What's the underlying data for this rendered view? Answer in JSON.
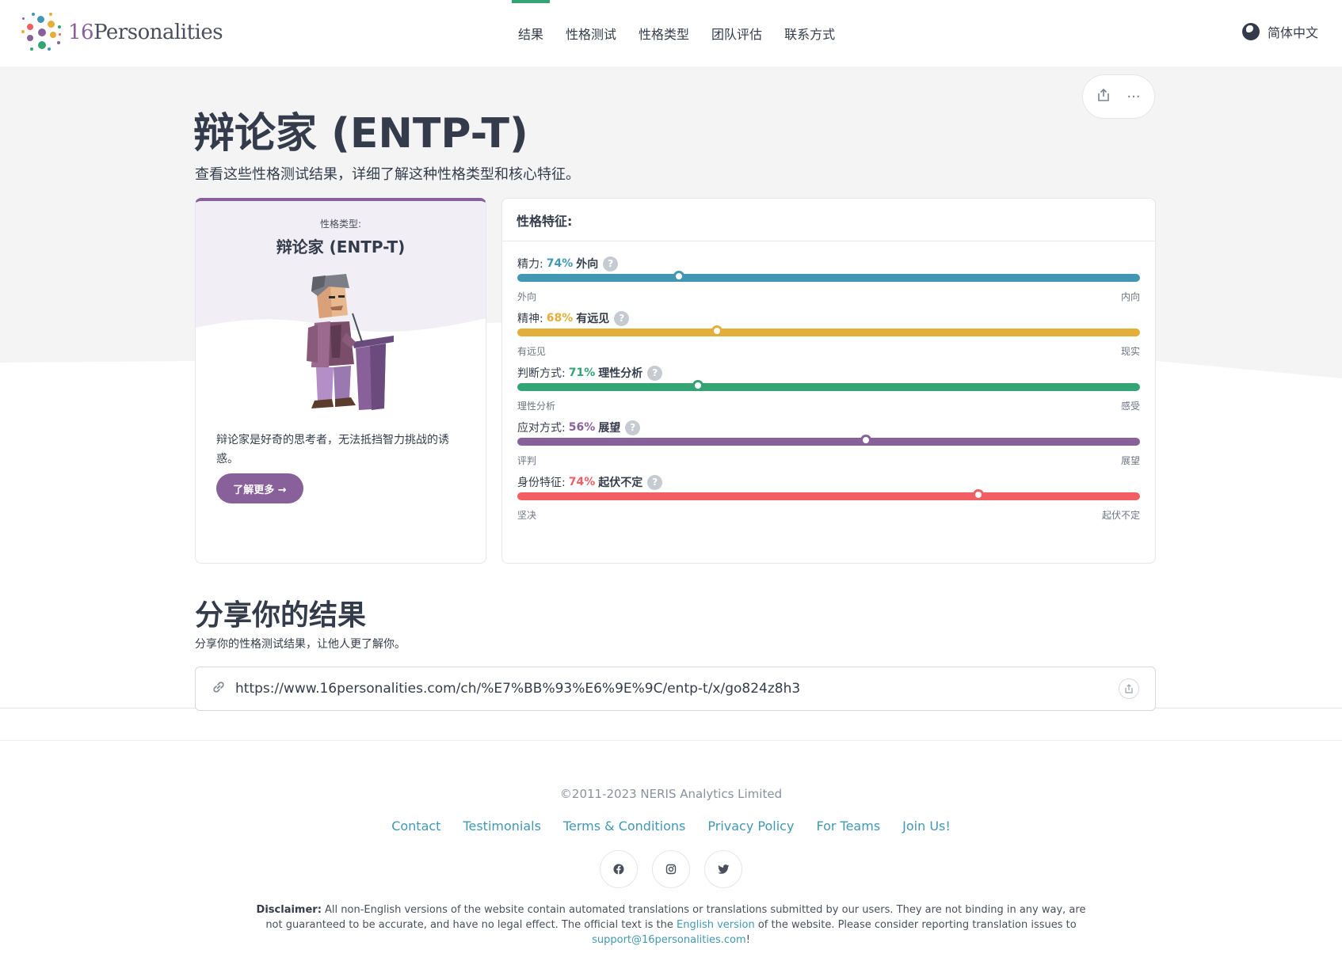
{
  "header": {
    "logo_num": "16",
    "logo_word": "Personalities",
    "nav": [
      {
        "label": "结果",
        "active": true
      },
      {
        "label": "性格测试",
        "active": false
      },
      {
        "label": "性格类型",
        "active": false
      },
      {
        "label": "团队评估",
        "active": false
      },
      {
        "label": "联系方式",
        "active": false
      }
    ],
    "language": "简体中文"
  },
  "page": {
    "title": "辩论家 (ENTP-T)",
    "subtitle": "查看这些性格测试结果，详细了解这种性格类型和核心特征。",
    "actions": {
      "share_icon": "share-icon",
      "more_icon": "more-icon"
    }
  },
  "type_card": {
    "label": "性格类型:",
    "name": "辩论家 (ENTP-T)",
    "description": "辩论家是好奇的思考者，无法抵挡智力挑战的诱惑。",
    "button": "了解更多 →",
    "accent": "#88619a"
  },
  "traits": {
    "heading": "性格特征:",
    "items": [
      {
        "prefix": "精力:",
        "percent": "74%",
        "name": "外向",
        "left": "外向",
        "right": "内向",
        "color": "#4298b4",
        "position": 0.26
      },
      {
        "prefix": "精神:",
        "percent": "68%",
        "name": "有远见",
        "left": "有远见",
        "right": "现实",
        "color": "#e4ae3a",
        "position": 0.32
      },
      {
        "prefix": "判断方式:",
        "percent": "71%",
        "name": "理性分析",
        "left": "理性分析",
        "right": "感受",
        "color": "#33a474",
        "position": 0.29
      },
      {
        "prefix": "应对方式:",
        "percent": "56%",
        "name": "展望",
        "left": "评判",
        "right": "展望",
        "color": "#88619a",
        "position": 0.56
      },
      {
        "prefix": "身份特征:",
        "percent": "74%",
        "name": "起伏不定",
        "left": "坚决",
        "right": "起伏不定",
        "color": "#f25e62",
        "position": 0.74
      }
    ]
  },
  "share": {
    "title": "分享你的结果",
    "subtitle": "分享你的性格测试结果，让他人更了解你。",
    "url": "https://www.16personalities.com/ch/%E7%BB%93%E6%9E%9C/entp-t/x/go824z8h3"
  },
  "footer": {
    "copyright": "©2011-2023 NERIS Analytics Limited",
    "links": [
      "Contact",
      "Testimonials",
      "Terms & Conditions",
      "Privacy Policy",
      "For Teams",
      "Join Us!"
    ],
    "socials": [
      "facebook-icon",
      "instagram-icon",
      "twitter-icon"
    ],
    "disclaimer_label": "Disclaimer:",
    "disclaimer_text": " All non-English versions of the website contain automated translations or translations submitted by our users. They are not binding in any way, are not guaranteed to be accurate, and have no legal effect. The official text is the ",
    "disclaimer_link1": "English version",
    "disclaimer_text2": " of the website. Please consider reporting translation issues to ",
    "disclaimer_link2": "support@16personalities.com",
    "disclaimer_end": "!"
  }
}
